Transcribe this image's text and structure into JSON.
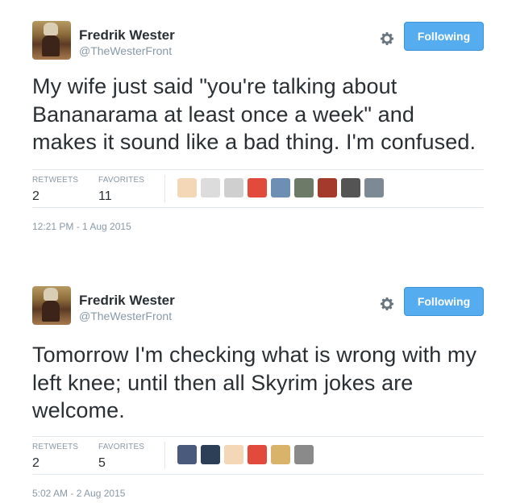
{
  "tweets": [
    {
      "user": {
        "name": "Fredrik Wester",
        "handle": "@TheWesterFront"
      },
      "follow_label": "Following",
      "text": "My wife just said \"you're talking about Bananarama at least once a week\" and makes it sound like a bad thing. I'm confused.",
      "stats": {
        "retweets_label": "RETWEETS",
        "retweets": "2",
        "favorites_label": "FAVORITES",
        "favorites": "11"
      },
      "favoriter_colors": [
        "#f3d7b6",
        "#dcdcdc",
        "#cfcfcf",
        "#e24a3b",
        "#6d8fb3",
        "#6c7a67",
        "#a33a2c",
        "#545454",
        "#7d8a95"
      ],
      "timestamp": "12:21 PM - 1 Aug 2015"
    },
    {
      "user": {
        "name": "Fredrik Wester",
        "handle": "@TheWesterFront"
      },
      "follow_label": "Following",
      "text": "Tomorrow I'm checking what is wrong with my left knee; until then all Skyrim jokes are welcome.",
      "stats": {
        "retweets_label": "RETWEETS",
        "retweets": "2",
        "favorites_label": "FAVORITES",
        "favorites": "5"
      },
      "favoriter_colors": [
        "#4a5a7a",
        "#2d3e57",
        "#f3d7b6",
        "#e24a3b",
        "#d9b36a",
        "#8a8a8a"
      ],
      "timestamp": "5:02 AM - 2 Aug 2015"
    }
  ]
}
